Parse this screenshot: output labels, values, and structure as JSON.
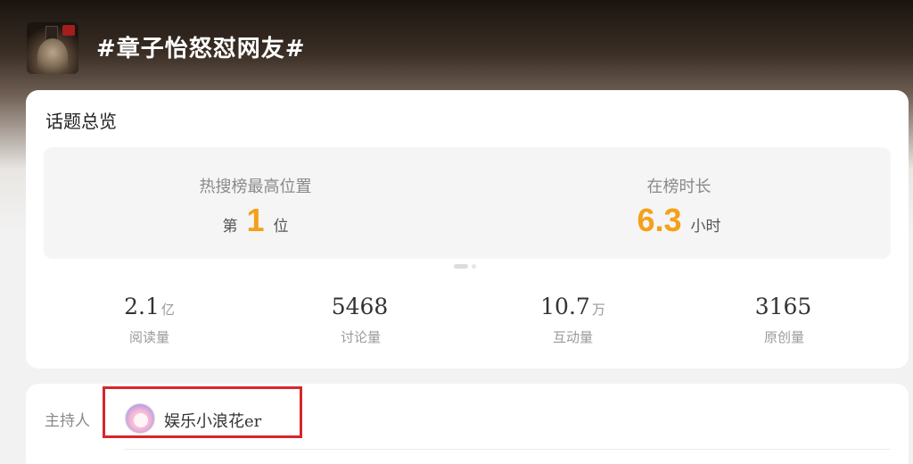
{
  "header": {
    "topic_title": "#章子怡怒怼网友#",
    "thumbnail_icon": "topic-cover-image"
  },
  "overview": {
    "title": "话题总览",
    "hot_search": {
      "label": "热搜榜最高位置",
      "prefix": "第",
      "value": "1",
      "suffix": "位"
    },
    "on_list_duration": {
      "label": "在榜时长",
      "value": "6.3",
      "suffix": "小时"
    },
    "pager": {
      "pages": 2,
      "active_index": 0
    },
    "stats": [
      {
        "value": "2.1",
        "unit": "亿",
        "label": "阅读量"
      },
      {
        "value": "5468",
        "unit": "",
        "label": "讨论量"
      },
      {
        "value": "10.7",
        "unit": "万",
        "label": "互动量"
      },
      {
        "value": "3165",
        "unit": "",
        "label": "原创量"
      }
    ],
    "colors": {
      "accent": "#f5a018"
    }
  },
  "host": {
    "label": "主持人",
    "name": "娱乐小浪花er",
    "highlight_color": "#d7262a"
  }
}
